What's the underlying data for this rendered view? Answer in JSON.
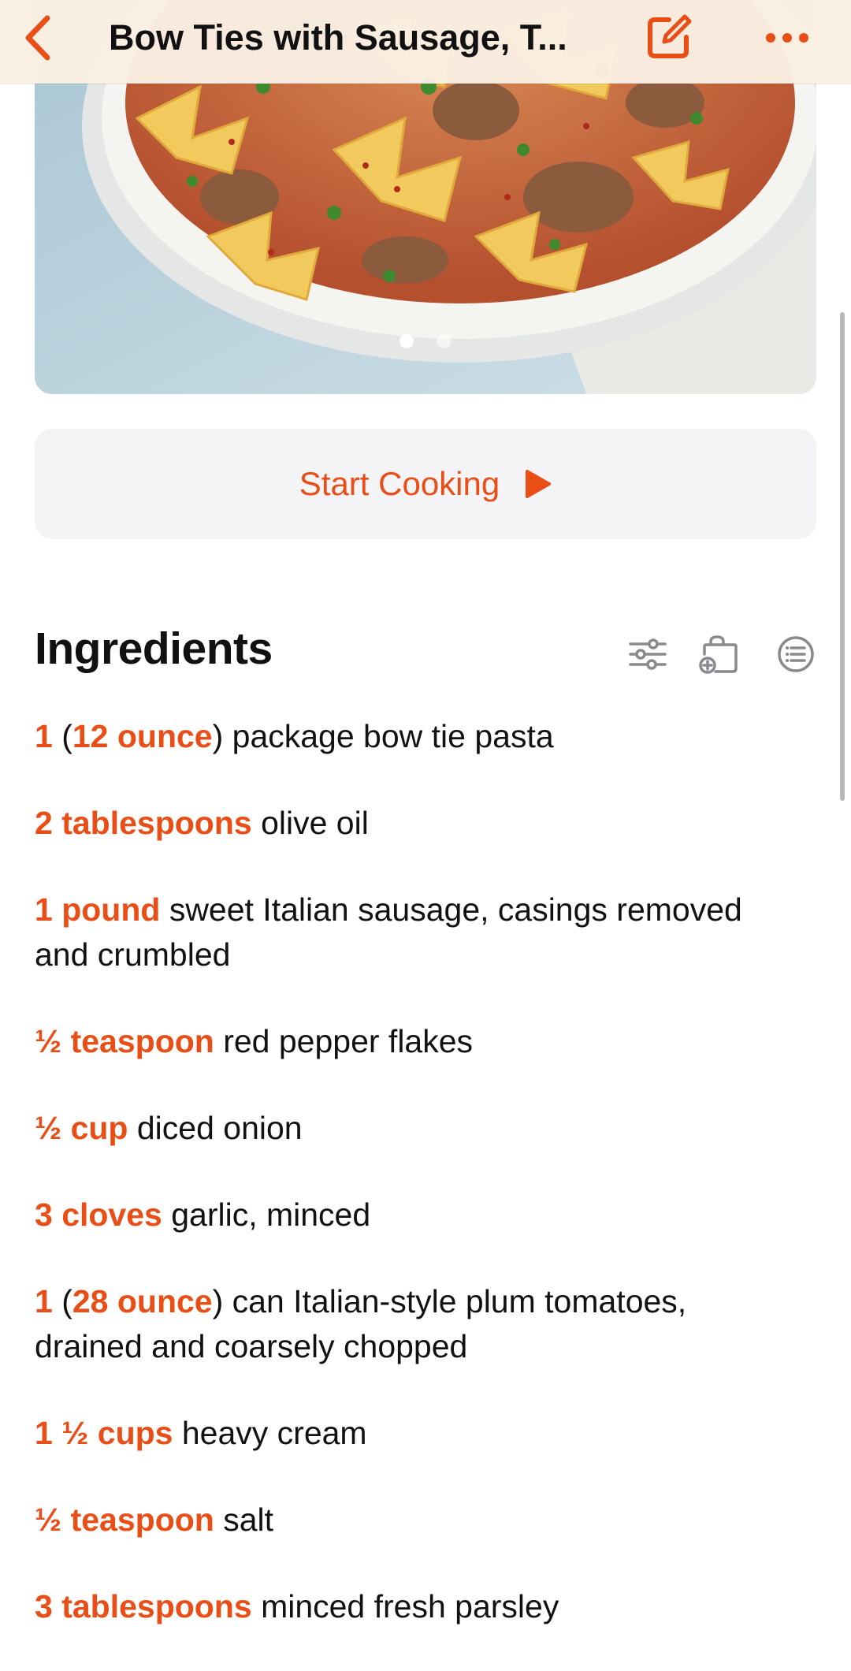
{
  "nav": {
    "title": "Bow Ties with Sausage, T...",
    "back_icon": "chevron-left-icon",
    "edit_icon": "edit-square-icon",
    "more_icon": "more-horizontal-icon"
  },
  "hero": {
    "carousel_pages": 2,
    "active_page": 1
  },
  "start_button": {
    "label": "Start Cooking",
    "icon": "play-icon"
  },
  "ingredients": {
    "title": "Ingredients",
    "tools": [
      "sliders-icon",
      "add-to-bag-icon",
      "list-circle-icon"
    ],
    "items": [
      {
        "qty": "1",
        "paren_qty": "12 ounce",
        "text": " package bow tie pasta"
      },
      {
        "qty": "2 tablespoons",
        "paren_qty": "",
        "text": " olive oil"
      },
      {
        "qty": "1 pound",
        "paren_qty": "",
        "text": " sweet Italian sausage, casings removed and crumbled"
      },
      {
        "qty": "½ teaspoon",
        "paren_qty": "",
        "text": " red pepper flakes"
      },
      {
        "qty": "½ cup",
        "paren_qty": "",
        "text": " diced onion"
      },
      {
        "qty": "3 cloves",
        "paren_qty": "",
        "text": " garlic, minced"
      },
      {
        "qty": "1",
        "paren_qty": "28 ounce",
        "text": " can Italian-style plum tomatoes, drained and coarsely chopped"
      },
      {
        "qty": "1 ½ cups",
        "paren_qty": "",
        "text": " heavy cream"
      },
      {
        "qty": "½ teaspoon",
        "paren_qty": "",
        "text": " salt"
      },
      {
        "qty": "3 tablespoons",
        "paren_qty": "",
        "text": " minced fresh parsley"
      }
    ]
  },
  "colors": {
    "accent": "#e94e16",
    "nav_bg": "#faeee2",
    "button_bg": "#f4f4f6",
    "text": "#111111"
  }
}
